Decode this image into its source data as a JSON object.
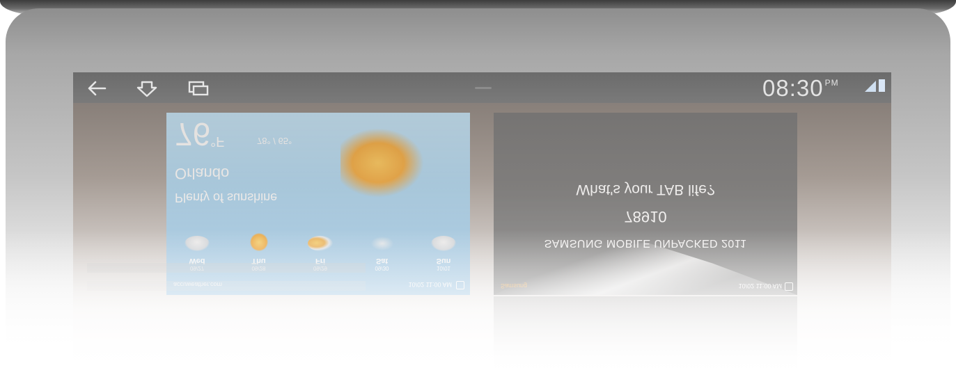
{
  "status_bar": {
    "time": "08:30",
    "ampm": "PM"
  },
  "weather_widget": {
    "source": "accuweather.com",
    "updated": "10/02 11:00 AM",
    "days": [
      {
        "name": "Wed",
        "date": "09/27",
        "icon": "cloudy-icon"
      },
      {
        "name": "Thu",
        "date": "09/28",
        "icon": "sunny-icon"
      },
      {
        "name": "Fri",
        "date": "09/29",
        "icon": "partly-sunny-icon"
      },
      {
        "name": "Sat",
        "date": "09/30",
        "icon": "windy-icon"
      },
      {
        "name": "Sun",
        "date": "10/01",
        "icon": "cloudy-icon"
      }
    ],
    "condition": "Plenty of sunshine",
    "city": "Orlando",
    "temperature": "76",
    "unit": "°F",
    "hilo": "78° / 65°"
  },
  "event_widget": {
    "logo": "Samsung",
    "updated": "10/02 11:00 AM",
    "title": "SAMSUNG MOBILE UNPACKED 2011",
    "code": "78910",
    "tagline": "What's your TAB life?"
  },
  "colors": {
    "statusbar": "#707070",
    "weather_card": "#a8d4f0",
    "event_card": "#767676"
  }
}
